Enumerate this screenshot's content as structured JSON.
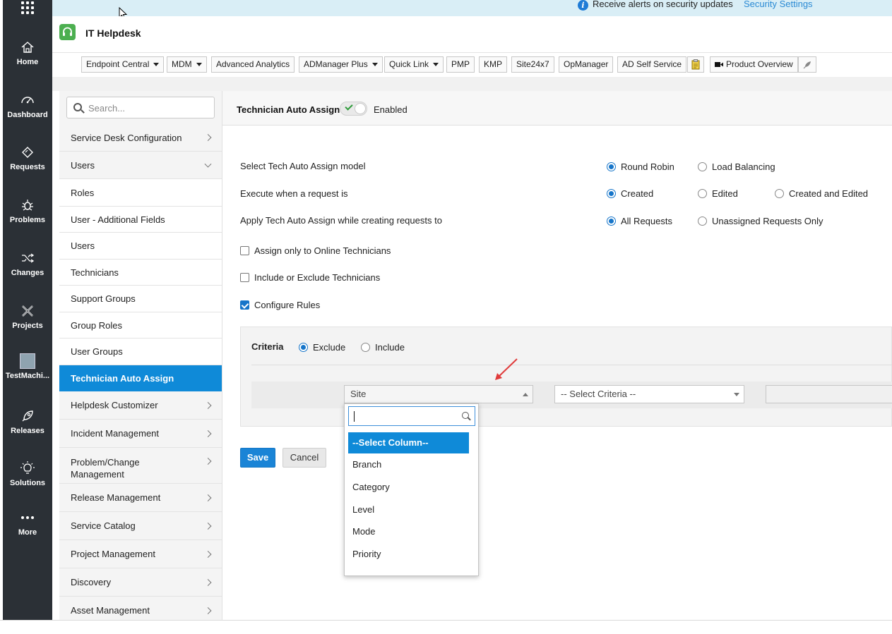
{
  "alert": {
    "text": "Receive alerts on security updates",
    "link": "Security Settings"
  },
  "app": {
    "title": "IT Helpdesk"
  },
  "rail": [
    {
      "label": "Home"
    },
    {
      "label": "Dashboard"
    },
    {
      "label": "Requests"
    },
    {
      "label": "Problems"
    },
    {
      "label": "Changes"
    },
    {
      "label": "Projects"
    },
    {
      "label": "TestMachi..."
    },
    {
      "label": "Releases"
    },
    {
      "label": "Solutions"
    },
    {
      "label": "More"
    }
  ],
  "quicklinks": [
    {
      "label": "Endpoint Central",
      "dropdown": true
    },
    {
      "label": "MDM",
      "dropdown": true
    },
    {
      "label": "Advanced Analytics",
      "dropdown": false
    },
    {
      "label": "ADManager Plus",
      "dropdown": true
    },
    {
      "label": "Quick Link",
      "dropdown": true
    },
    {
      "label": "PMP",
      "dropdown": false
    },
    {
      "label": "KMP",
      "dropdown": false
    },
    {
      "label": "Site24x7",
      "dropdown": false
    },
    {
      "label": "OpManager",
      "dropdown": false
    },
    {
      "label": "AD Self Service",
      "dropdown": false
    },
    {
      "label": "Product Overview",
      "dropdown": false
    }
  ],
  "sidebar": {
    "search_placeholder": "Search...",
    "items": [
      {
        "label": "Service Desk Configuration"
      },
      {
        "label": "Users"
      },
      {
        "label": "Roles"
      },
      {
        "label": "User - Additional Fields"
      },
      {
        "label": "Users"
      },
      {
        "label": "Technicians"
      },
      {
        "label": "Support Groups"
      },
      {
        "label": "Group Roles"
      },
      {
        "label": "User Groups"
      },
      {
        "label": "Technician Auto Assign"
      },
      {
        "label": "Helpdesk Customizer"
      },
      {
        "label": "Incident Management"
      },
      {
        "label": "Problem/Change Management"
      },
      {
        "label": "Release Management"
      },
      {
        "label": "Service Catalog"
      },
      {
        "label": "Project Management"
      },
      {
        "label": "Discovery"
      },
      {
        "label": "Asset Management"
      }
    ]
  },
  "page": {
    "title": "Technician Auto Assign",
    "toggle_status": "Enabled",
    "model_label": "Select Tech Auto Assign model",
    "model_options": [
      "Round Robin",
      "Load Balancing"
    ],
    "execute_label": "Execute when a request is",
    "execute_options": [
      "Created",
      "Edited",
      "Created and Edited"
    ],
    "apply_label": "Apply Tech Auto Assign while creating requests to",
    "apply_options": [
      "All Requests",
      "Unassigned Requests Only"
    ],
    "checkboxes": [
      {
        "label": "Assign only to Online Technicians",
        "checked": false
      },
      {
        "label": "Include or Exclude Technicians",
        "checked": false
      },
      {
        "label": "Configure Rules",
        "checked": true
      }
    ],
    "criteria": {
      "title": "Criteria",
      "options": [
        "Exclude",
        "Include"
      ],
      "column_value": "Site",
      "criteria_placeholder": "-- Select Criteria --"
    },
    "save_label": "Save",
    "cancel_label": "Cancel"
  },
  "dropdown": {
    "search_value": "",
    "options": [
      "--Select Column--",
      "Branch",
      "Category",
      "Level",
      "Mode",
      "Priority"
    ]
  },
  "colors": {
    "accent": "#0f8ad8",
    "rail": "#2b3036",
    "brand": "#4caf50"
  }
}
